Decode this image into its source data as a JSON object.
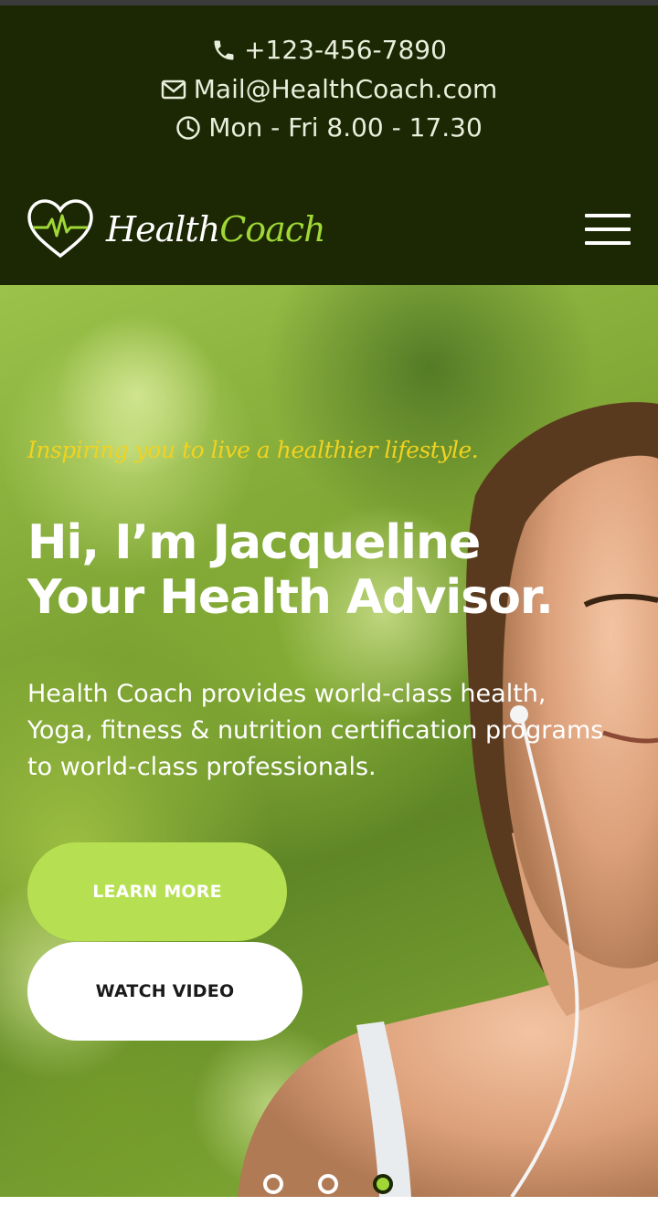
{
  "contact": {
    "phone": "+123-456-7890",
    "email": "Mail@HealthCoach.com",
    "hours": "Mon - Fri 8.00 - 17.30"
  },
  "header": {
    "logo_part1": "Health",
    "logo_part2": "Coach",
    "menu_icon": "hamburger-menu-icon"
  },
  "hero": {
    "tagline": "Inspiring you to live a healthier lifestyle.",
    "headline_line1": "Hi, I’m Jacqueline",
    "headline_line2": "Your Health Advisor.",
    "description": "Health Coach provides world-class health, Yoga, fitness & nutrition certification programs to world-class professionals.",
    "learn_more_label": "LEARN MORE",
    "watch_video_label": "WATCH VIDEO"
  },
  "slider": {
    "total_slides": 3,
    "active_slide": 3
  },
  "colors": {
    "dark_green": "#1c2704",
    "accent_green": "#b6e052",
    "tagline_yellow": "#f2d21f"
  }
}
